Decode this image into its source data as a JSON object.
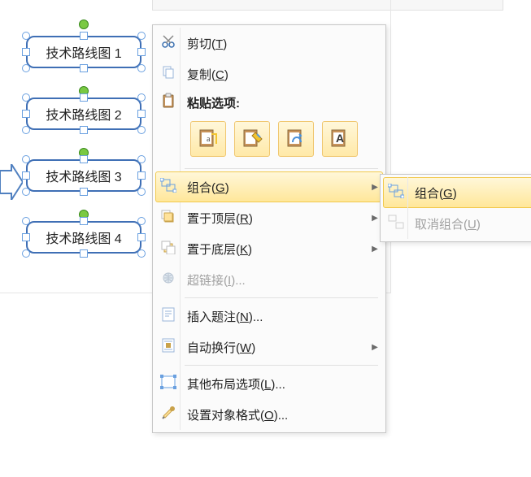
{
  "shapes": [
    {
      "label": "技术路线图 1"
    },
    {
      "label": "技术路线图 2"
    },
    {
      "label": "技术路线图 3"
    },
    {
      "label": "技术路线图 4"
    }
  ],
  "context_menu": {
    "cut": {
      "text": "剪切",
      "accel": "T"
    },
    "copy": {
      "text": "复制",
      "accel": "C"
    },
    "paste_header": "粘贴选项:",
    "paste_options": [
      {
        "name": "keep-source-formatting"
      },
      {
        "name": "use-destination-theme"
      },
      {
        "name": "picture"
      },
      {
        "name": "keep-text-only"
      }
    ],
    "group": {
      "text": "组合",
      "accel": "G"
    },
    "bring_front": {
      "text": "置于顶层",
      "accel": "R"
    },
    "send_back": {
      "text": "置于底层",
      "accel": "K"
    },
    "hyperlink": {
      "text": "超链接",
      "accel": "I",
      "suffix": "..."
    },
    "caption": {
      "text": "插入题注",
      "accel": "N",
      "suffix": "..."
    },
    "wrap": {
      "text": "自动换行",
      "accel": "W"
    },
    "layout": {
      "text": "其他布局选项",
      "accel": "L",
      "suffix": "..."
    },
    "format": {
      "text": "设置对象格式",
      "accel": "O",
      "suffix": "..."
    }
  },
  "submenu": {
    "group": {
      "text": "组合",
      "accel": "G"
    },
    "ungroup": {
      "text": "取消组合",
      "accel": "U"
    }
  }
}
